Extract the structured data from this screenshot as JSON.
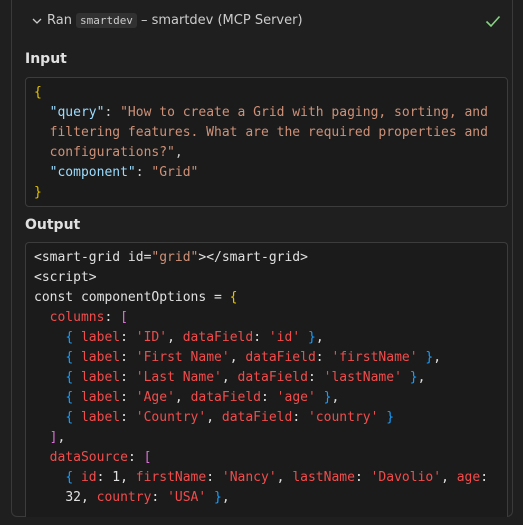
{
  "header": {
    "ran_label": "Ran",
    "tool_name": "smartdev",
    "server_desc": "– smartdev (MCP Server)"
  },
  "input": {
    "label": "Input",
    "lines": [
      [
        [
          "y",
          "{"
        ]
      ],
      [
        [
          "p",
          "  "
        ],
        [
          "k",
          "\"query\""
        ],
        [
          "p",
          ": "
        ],
        [
          "s",
          "\"How to create a Grid with paging, sorting, and"
        ]
      ],
      [
        [
          "s",
          "  filtering features. What are the required properties and"
        ]
      ],
      [
        [
          "s",
          "  configurations?\""
        ],
        [
          "p",
          ","
        ]
      ],
      [
        [
          "p",
          "  "
        ],
        [
          "k",
          "\"component\""
        ],
        [
          "p",
          ": "
        ],
        [
          "s",
          "\"Grid\""
        ]
      ],
      [
        [
          "y",
          "}"
        ]
      ]
    ]
  },
  "output": {
    "label": "Output",
    "lines": [
      [
        [
          "t",
          "<smart-grid id="
        ],
        [
          "s",
          "\"grid\""
        ],
        [
          "t",
          "></smart-grid>"
        ]
      ],
      [
        [
          "t",
          "<script>"
        ]
      ],
      [
        [
          "t",
          "const componentOptions = "
        ],
        [
          "y",
          "{"
        ]
      ],
      [
        [
          "p",
          "  "
        ],
        [
          "r",
          "columns"
        ],
        [
          "t",
          ": "
        ],
        [
          "pk",
          "["
        ]
      ],
      [
        [
          "p",
          "    "
        ],
        [
          "ob",
          "{ "
        ],
        [
          "r",
          "label"
        ],
        [
          "t",
          ": "
        ],
        [
          "r",
          "'ID'"
        ],
        [
          "t",
          ", "
        ],
        [
          "r",
          "dataField"
        ],
        [
          "t",
          ": "
        ],
        [
          "r",
          "'id'"
        ],
        [
          "t",
          " "
        ],
        [
          "ob",
          "}"
        ],
        [
          "t",
          ","
        ]
      ],
      [
        [
          "p",
          "    "
        ],
        [
          "ob",
          "{ "
        ],
        [
          "r",
          "label"
        ],
        [
          "t",
          ": "
        ],
        [
          "r",
          "'First Name'"
        ],
        [
          "t",
          ", "
        ],
        [
          "r",
          "dataField"
        ],
        [
          "t",
          ": "
        ],
        [
          "r",
          "'firstName'"
        ],
        [
          "t",
          " "
        ],
        [
          "ob",
          "}"
        ],
        [
          "t",
          ","
        ]
      ],
      [
        [
          "p",
          "    "
        ],
        [
          "ob",
          "{ "
        ],
        [
          "r",
          "label"
        ],
        [
          "t",
          ": "
        ],
        [
          "r",
          "'Last Name'"
        ],
        [
          "t",
          ", "
        ],
        [
          "r",
          "dataField"
        ],
        [
          "t",
          ": "
        ],
        [
          "r",
          "'lastName'"
        ],
        [
          "t",
          " "
        ],
        [
          "ob",
          "}"
        ],
        [
          "t",
          ","
        ]
      ],
      [
        [
          "p",
          "    "
        ],
        [
          "ob",
          "{ "
        ],
        [
          "r",
          "label"
        ],
        [
          "t",
          ": "
        ],
        [
          "r",
          "'Age'"
        ],
        [
          "t",
          ", "
        ],
        [
          "r",
          "dataField"
        ],
        [
          "t",
          ": "
        ],
        [
          "r",
          "'age'"
        ],
        [
          "t",
          " "
        ],
        [
          "ob",
          "}"
        ],
        [
          "t",
          ","
        ]
      ],
      [
        [
          "p",
          "    "
        ],
        [
          "ob",
          "{ "
        ],
        [
          "r",
          "label"
        ],
        [
          "t",
          ": "
        ],
        [
          "r",
          "'Country'"
        ],
        [
          "t",
          ", "
        ],
        [
          "r",
          "dataField"
        ],
        [
          "t",
          ": "
        ],
        [
          "r",
          "'country'"
        ],
        [
          "t",
          " "
        ],
        [
          "ob",
          "}"
        ]
      ],
      [
        [
          "p",
          "  "
        ],
        [
          "pk",
          "]"
        ],
        [
          "t",
          ","
        ]
      ],
      [
        [
          "p",
          "  "
        ],
        [
          "r",
          "dataSource"
        ],
        [
          "t",
          ": "
        ],
        [
          "pk",
          "["
        ]
      ],
      [
        [
          "p",
          "    "
        ],
        [
          "ob",
          "{ "
        ],
        [
          "r",
          "id"
        ],
        [
          "t",
          ": 1, "
        ],
        [
          "r",
          "firstName"
        ],
        [
          "t",
          ": "
        ],
        [
          "r",
          "'Nancy'"
        ],
        [
          "t",
          ", "
        ],
        [
          "r",
          "lastName"
        ],
        [
          "t",
          ": "
        ],
        [
          "r",
          "'Davolio'"
        ],
        [
          "t",
          ", "
        ],
        [
          "r",
          "age"
        ],
        [
          "t",
          ":"
        ]
      ],
      [
        [
          "p",
          "    "
        ],
        [
          "t",
          "32, "
        ],
        [
          "r",
          "country"
        ],
        [
          "t",
          ": "
        ],
        [
          "r",
          "'USA'"
        ],
        [
          "t",
          " "
        ],
        [
          "ob",
          "}"
        ],
        [
          "t",
          ","
        ]
      ]
    ]
  },
  "colors": {
    "background": "#1f1f1f",
    "check": "#89d185",
    "string": "#ce9178",
    "key": "#9cdcfe",
    "brace": "#e6c400",
    "property": "#f14c4c"
  }
}
